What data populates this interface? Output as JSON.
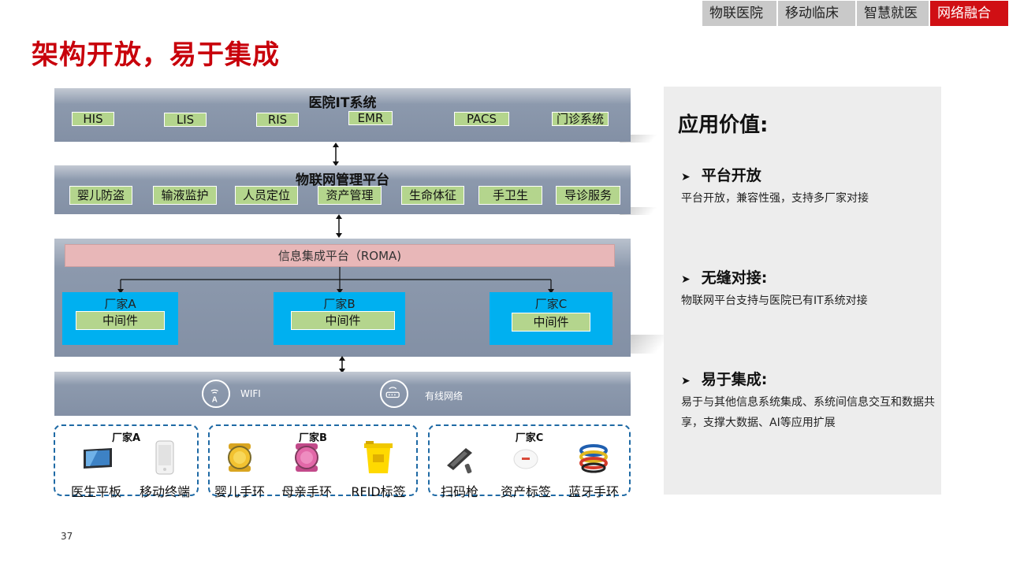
{
  "nav": {
    "tabs": [
      "物联医院",
      "移动临床",
      "智慧就医",
      "网络融合"
    ],
    "active_index": 3
  },
  "title": "架构开放，易于集成",
  "diagram": {
    "it_layer": {
      "title": "医院IT系统",
      "systems": [
        "HIS",
        "LIS",
        "RIS",
        "EMR",
        "PACS",
        "门诊系统"
      ]
    },
    "iot_layer": {
      "title": "物联网管理平台",
      "apps": [
        "婴儿防盗",
        "输液监护",
        "人员定位",
        "资产管理",
        "生命体征",
        "手卫生",
        "导诊服务"
      ]
    },
    "integration_layer": {
      "platform": "信息集成平台（ROMA)",
      "vendors": [
        {
          "name": "厂家A",
          "middleware": "中间件"
        },
        {
          "name": "厂家B",
          "middleware": "中间件"
        },
        {
          "name": "厂家C",
          "middleware": "中间件"
        }
      ]
    },
    "network_layer": {
      "wifi_label": "WIFI",
      "wired_label": "有线网络"
    },
    "device_groups": [
      {
        "name": "厂家A",
        "devices": [
          {
            "label": "医生平板",
            "icon": "tablet-icon"
          },
          {
            "label": "移动终端",
            "icon": "mobile-phone-icon"
          }
        ]
      },
      {
        "name": "厂家B",
        "devices": [
          {
            "label": "婴儿手环",
            "icon": "infant-band-icon"
          },
          {
            "label": "母亲手环",
            "icon": "mother-band-icon"
          },
          {
            "label": "RFID标签",
            "icon": "rfid-tag-icon"
          }
        ]
      },
      {
        "name": "厂家C",
        "devices": [
          {
            "label": "扫码枪",
            "icon": "barcode-scanner-icon"
          },
          {
            "label": "资产标签",
            "icon": "asset-tag-icon"
          },
          {
            "label": "蓝牙手环",
            "icon": "bluetooth-band-icon"
          }
        ]
      }
    ]
  },
  "value_panel": {
    "title": "应用价值:",
    "sections": [
      {
        "heading": "平台开放",
        "body": "平台开放，兼容性强，支持多厂家对接"
      },
      {
        "heading": "无缝对接:",
        "body": "物联网平台支持与医院已有IT系统对接"
      },
      {
        "heading": "易于集成:",
        "body": "易于与其他信息系统集成、系统间信息交互和数据共享，支撑大数据、AI等应用扩展"
      }
    ]
  },
  "page_number": "37",
  "colors": {
    "brand_red": "#c8000b",
    "tab_active": "#d00f14",
    "layer_blue_gray": "#8390a5",
    "green_box": "#b4d58d",
    "vendor_blue": "#00b0f0",
    "roma_pink": "#e8b7b8",
    "dashed_border": "#1f6aa5",
    "panel_gray": "#ededed"
  }
}
